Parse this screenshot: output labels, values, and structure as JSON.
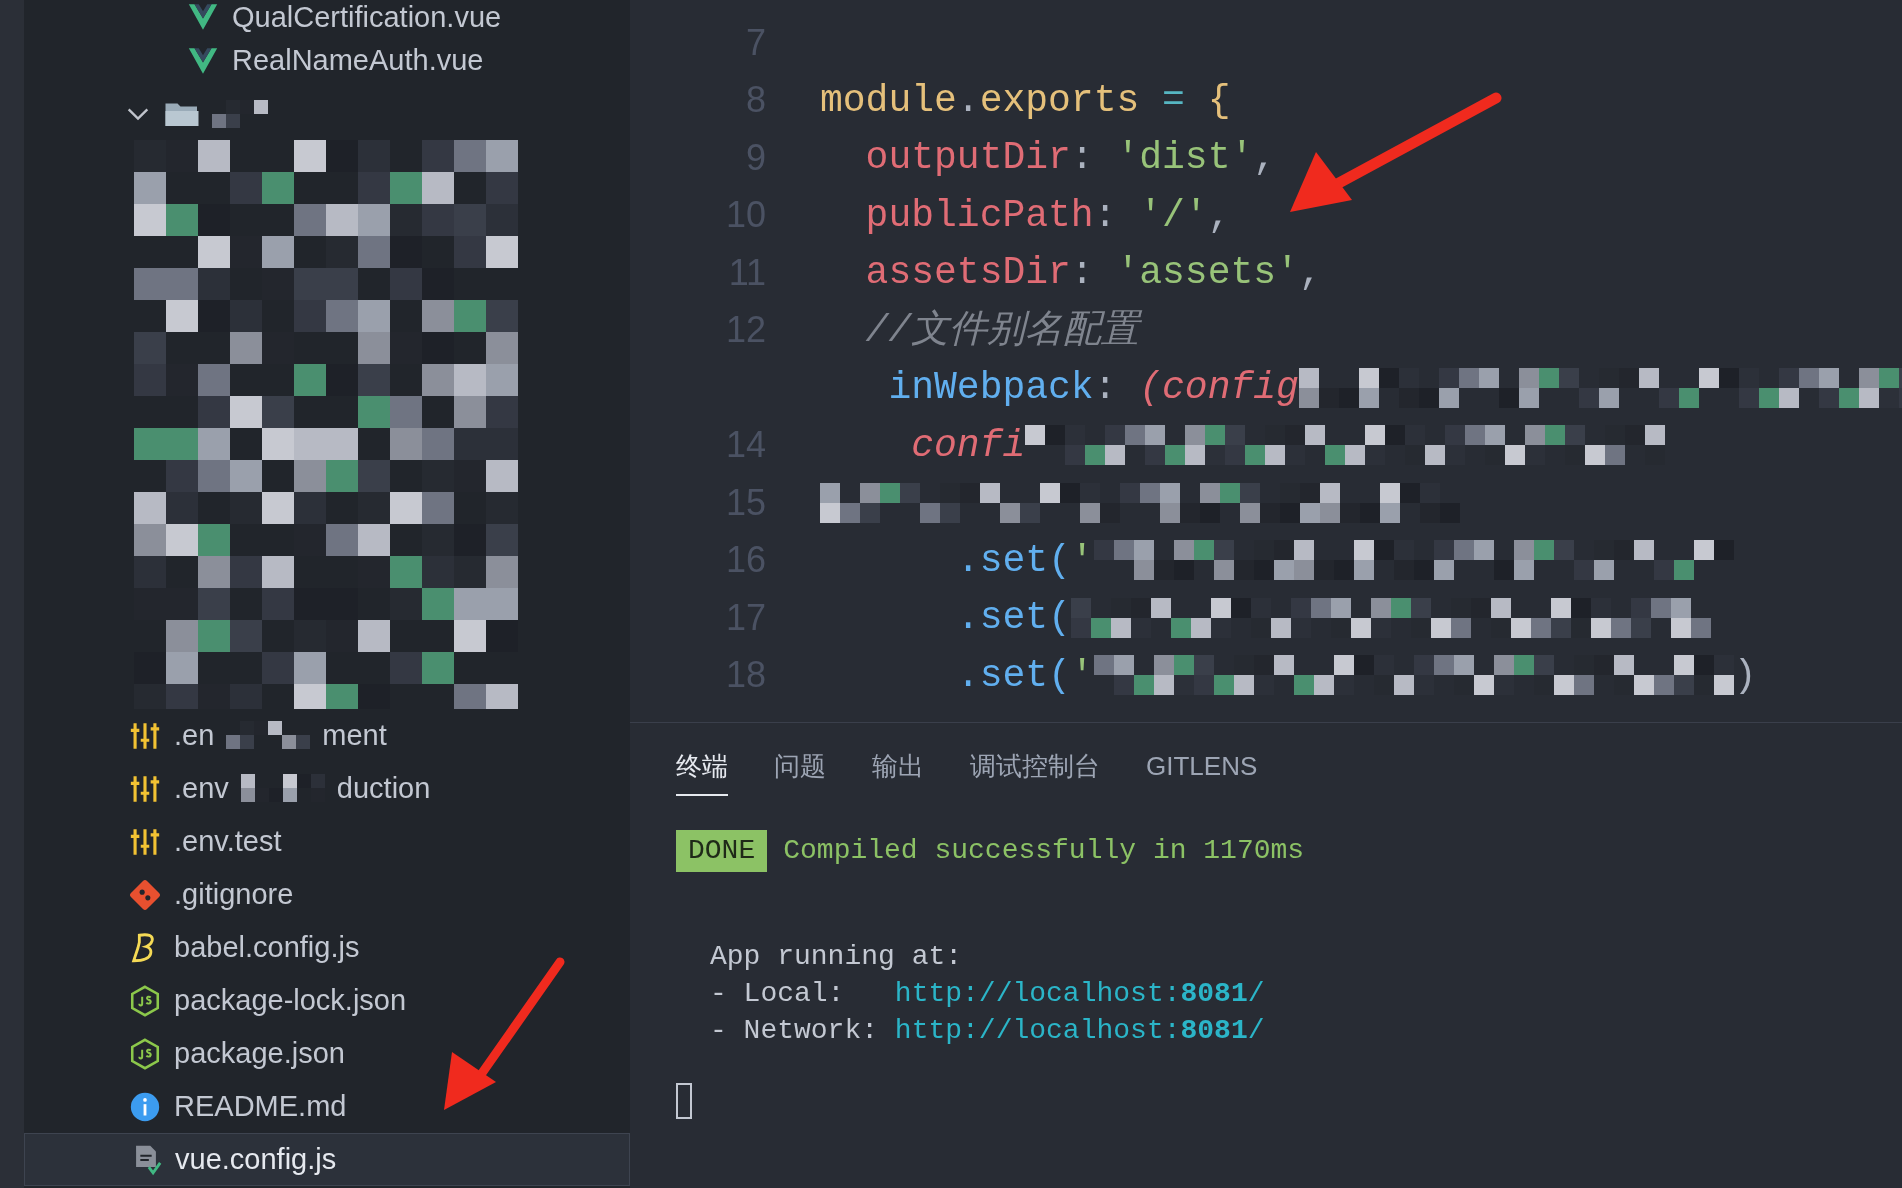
{
  "sidebar": {
    "items": [
      {
        "kind": "vue",
        "name": "QualCertification.vue",
        "selected": false
      },
      {
        "kind": "vue",
        "name": "RealNameAuth.vue",
        "selected": false
      },
      {
        "kind": "folder",
        "expanded": true
      },
      {
        "kind": "env",
        "name": ".en",
        "name_end": "ment",
        "selected": false
      },
      {
        "kind": "env",
        "name": ".env",
        "name_end": "duction",
        "selected": false
      },
      {
        "kind": "env",
        "name": ".env.test",
        "selected": false
      },
      {
        "kind": "git",
        "name": ".gitignore",
        "selected": false
      },
      {
        "kind": "babel",
        "name": "babel.config.js",
        "selected": false
      },
      {
        "kind": "node",
        "name": "package-lock.json",
        "selected": false
      },
      {
        "kind": "node",
        "name": "package.json",
        "selected": false
      },
      {
        "kind": "info",
        "name": "README.md",
        "selected": false
      },
      {
        "kind": "vueconfig",
        "name": "vue.config.js",
        "selected": true
      }
    ]
  },
  "editor": {
    "lines": [
      {
        "number": "7"
      },
      {
        "number": "8",
        "tokens": [
          {
            "kind": "object",
            "text": "module"
          },
          {
            "kind": "punct",
            "text": "."
          },
          {
            "kind": "object",
            "text": "exports"
          },
          {
            "kind": "operator",
            "text": " = "
          },
          {
            "kind": "brace",
            "text": "{"
          }
        ]
      },
      {
        "number": "9",
        "tokens": [
          {
            "kind": "key",
            "text": "  outputDir"
          },
          {
            "kind": "punct",
            "text": ": "
          },
          {
            "kind": "string",
            "text": "'dist'"
          },
          {
            "kind": "punct",
            "text": ","
          }
        ]
      },
      {
        "number": "10",
        "tokens": [
          {
            "kind": "key",
            "text": "  publicPath"
          },
          {
            "kind": "punct",
            "text": ": "
          },
          {
            "kind": "string",
            "text": "'/'"
          },
          {
            "kind": "punct",
            "text": ","
          }
        ]
      },
      {
        "number": "11",
        "tokens": [
          {
            "kind": "key",
            "text": "  assetsDir"
          },
          {
            "kind": "punct",
            "text": ": "
          },
          {
            "kind": "string",
            "text": "'assets'"
          },
          {
            "kind": "punct",
            "text": ","
          }
        ]
      },
      {
        "number": "12",
        "tokens": [
          {
            "kind": "comment",
            "text": "  //文件别名配置"
          }
        ]
      },
      {
        "tokens": [
          {
            "kind": "method",
            "text": "   inWebpack"
          },
          {
            "kind": "punct",
            "text": ": "
          },
          {
            "kind": "param",
            "text": "(config"
          },
          {
            "kind": "mosaic"
          }
        ]
      },
      {
        "number": "14",
        "tokens": [
          {
            "kind": "param",
            "text": "    confi"
          },
          {
            "kind": "mosaic"
          }
        ]
      },
      {
        "number": "15",
        "tokens": [
          {
            "kind": "mosaic"
          }
        ]
      },
      {
        "number": "16",
        "tokens": [
          {
            "kind": "method",
            "text": "      .set("
          },
          {
            "kind": "string",
            "text": "'"
          },
          {
            "kind": "mosaic"
          }
        ]
      },
      {
        "number": "17",
        "tokens": [
          {
            "kind": "method",
            "text": "      .set("
          },
          {
            "kind": "mosaic"
          }
        ]
      },
      {
        "number": "18",
        "tokens": [
          {
            "kind": "method",
            "text": "      .set("
          },
          {
            "kind": "string",
            "text": "'"
          },
          {
            "kind": "mosaic"
          },
          {
            "kind": "punct",
            "text": ")"
          }
        ]
      }
    ]
  },
  "panel": {
    "tabs": [
      {
        "label": "终端",
        "selected": true
      },
      {
        "label": "问题",
        "selected": false
      },
      {
        "label": "输出",
        "selected": false
      },
      {
        "label": "调试控制台",
        "selected": false
      },
      {
        "label": "GITLENS",
        "selected": false
      }
    ],
    "terminal": {
      "badge": "DONE",
      "message": "Compiled successfully in 1170ms",
      "heading": "App running at:",
      "urls": [
        {
          "label": "- Local:   ",
          "url": "http://localhost:**8081**/"
        },
        {
          "label": "- Network: ",
          "url": "http://localhost:**8081**/"
        }
      ]
    }
  }
}
